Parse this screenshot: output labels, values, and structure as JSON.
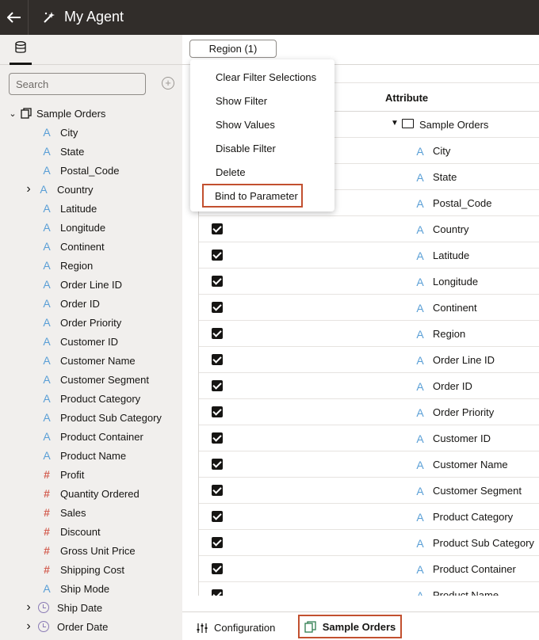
{
  "header": {
    "title": "My Agent"
  },
  "sidebar": {
    "search_placeholder": "Search",
    "root": "Sample Orders",
    "items": [
      {
        "label": "City",
        "type": "text"
      },
      {
        "label": "State",
        "type": "text"
      },
      {
        "label": "Postal_Code",
        "type": "text"
      },
      {
        "label": "Country",
        "type": "text",
        "expandable": true
      },
      {
        "label": "Latitude",
        "type": "text"
      },
      {
        "label": "Longitude",
        "type": "text"
      },
      {
        "label": "Continent",
        "type": "text"
      },
      {
        "label": "Region",
        "type": "text"
      },
      {
        "label": "Order Line ID",
        "type": "text"
      },
      {
        "label": "Order ID",
        "type": "text"
      },
      {
        "label": "Order Priority",
        "type": "text"
      },
      {
        "label": "Customer ID",
        "type": "text"
      },
      {
        "label": "Customer Name",
        "type": "text"
      },
      {
        "label": "Customer Segment",
        "type": "text"
      },
      {
        "label": "Product Category",
        "type": "text"
      },
      {
        "label": "Product Sub Category",
        "type": "text"
      },
      {
        "label": "Product Container",
        "type": "text"
      },
      {
        "label": "Product Name",
        "type": "text"
      },
      {
        "label": "Profit",
        "type": "number"
      },
      {
        "label": "Quantity Ordered",
        "type": "number"
      },
      {
        "label": "Sales",
        "type": "number"
      },
      {
        "label": "Discount",
        "type": "number"
      },
      {
        "label": "Gross Unit Price",
        "type": "number"
      },
      {
        "label": "Shipping Cost",
        "type": "number"
      },
      {
        "label": "Ship Mode",
        "type": "text"
      },
      {
        "label": "Ship Date",
        "type": "date",
        "expandable": true
      },
      {
        "label": "Order Date",
        "type": "date",
        "expandable": true
      }
    ]
  },
  "filter": {
    "pill_label": "Region (1)"
  },
  "menu": {
    "items": [
      "Clear Filter Selections",
      "Show Filter",
      "Show Values",
      "Disable Filter",
      "Delete",
      "Bind to Parameter"
    ]
  },
  "grid": {
    "attribute_header": "Attribute",
    "folder": "Sample Orders",
    "rows": [
      "City",
      "State",
      "Postal_Code",
      "Country",
      "Latitude",
      "Longitude",
      "Continent",
      "Region",
      "Order Line ID",
      "Order ID",
      "Order Priority",
      "Customer ID",
      "Customer Name",
      "Customer Segment",
      "Product Category",
      "Product Sub Category",
      "Product Container",
      "Product Name"
    ]
  },
  "bottom_tabs": {
    "configuration": "Configuration",
    "sample_orders": "Sample Orders"
  },
  "colors": {
    "accent_highlight": "#c2502f",
    "text_attr_icon": "#5a9fd6",
    "number_icon": "#d46255",
    "title_bar": "#312d2a"
  }
}
